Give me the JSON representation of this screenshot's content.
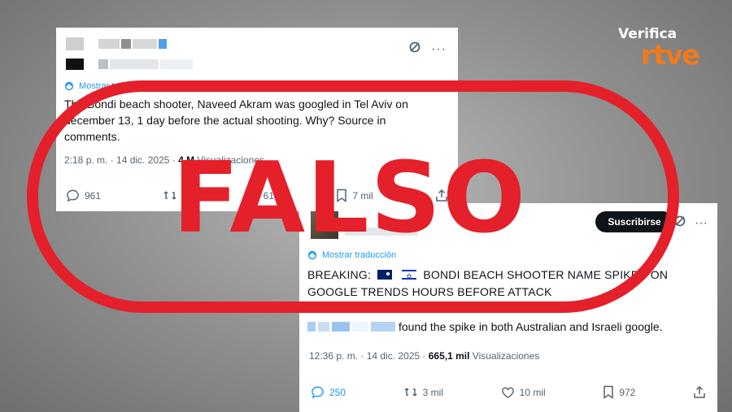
{
  "logo": {
    "verifica": "Verifica",
    "brand": "rtve",
    "brand_color": "#f27a1a"
  },
  "stamp": {
    "text": "FALSO",
    "color": "#e4202a"
  },
  "tweet1": {
    "translate_label": "Mostrar traducción",
    "body": "The Bondi beach shooter, Naveed Akram was googled in Tel Aviv on december 13, 1 day before the actual shooting. Why?  Source in comments.",
    "time": "2:18 p. m. · 14 dic. 2025 · ",
    "views_count": "4 M",
    "views_label": " Visualizaciones",
    "replies": "961",
    "reposts": "",
    "likes": "61",
    "bookmarks": "7 mil",
    "icons": [
      "grok-icon",
      "more-icon",
      "reply-icon",
      "repost-icon",
      "like-icon",
      "bookmark-icon",
      "share-icon"
    ]
  },
  "tweet2": {
    "subscribe_label": "Suscribirse",
    "translate_label": "Mostrar traducción",
    "headline_prefix": "BREAKING:",
    "headline_text": "BONDI BEACH SHOOTER NAME SPIKED ON GOOGLE TRENDS HOURS BEFORE ATTACK",
    "body_text": "found the spike in both Australian and Israeli google.",
    "time": "12:36 p. m. · 14 dic. 2025 · ",
    "views_count": "665,1 mil",
    "views_label": " Visualizaciones",
    "replies": "250",
    "reposts": "3 mil",
    "likes": "10 mil",
    "bookmarks": "972"
  }
}
